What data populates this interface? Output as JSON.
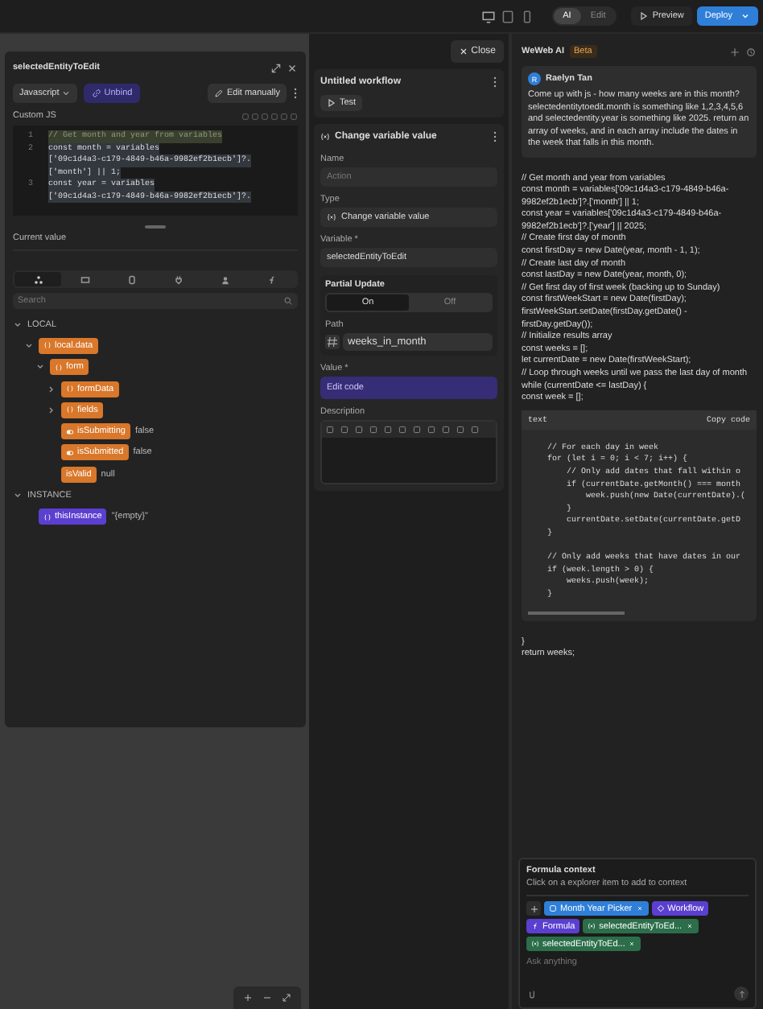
{
  "topbar": {
    "mode_tabs": [
      {
        "label": "AI",
        "selected": true
      },
      {
        "label": "Edit",
        "selected": false
      }
    ],
    "preview": "Preview",
    "deploy": "Deploy"
  },
  "binding_panel": {
    "title": "selectedEntityToEdit",
    "language": "Javascript",
    "unbind": "Unbind",
    "edit_manually": "Edit manually",
    "section": "Custom JS",
    "code_lines": [
      {
        "number": "1",
        "kind": "comment",
        "text": "// Get month and year from variables"
      },
      {
        "number": "2",
        "kind": "code",
        "text": "const month = variables"
      },
      {
        "kind": "code",
        "text": "['09c1d4a3-c179-4849-b46a-9982ef2b1ecb']?."
      },
      {
        "kind": "code",
        "text": "['month'] || 1;"
      },
      {
        "number": "3",
        "kind": "code",
        "text": "const year = variables"
      },
      {
        "kind": "code",
        "text": "['09c1d4a3-c179-4849-b46a-9982ef2b1ecb']?."
      }
    ],
    "current_value_label": "Current value",
    "explorer_tabs": [
      {
        "kind": "tree",
        "selected": true
      },
      {
        "kind": "grid",
        "selected": false
      },
      {
        "kind": "database",
        "selected": false
      },
      {
        "kind": "plug",
        "selected": false
      },
      {
        "kind": "user",
        "selected": false
      },
      {
        "kind": "function",
        "selected": false
      }
    ],
    "search": {
      "placeholder": "Search"
    },
    "tree": [
      {
        "label": "LOCAL",
        "expanded": true,
        "children": [
          {
            "label": "local.data",
            "kind": "object",
            "color": "#d9772a",
            "expanded": true,
            "children": [
              {
                "label": "form",
                "kind": "object",
                "color": "#d9772a",
                "expanded": true,
                "children": [
                  {
                    "label": "formData",
                    "kind": "object",
                    "color": "#d9772a",
                    "expanded": false
                  },
                  {
                    "label": "fields",
                    "kind": "object",
                    "color": "#d9772a",
                    "expanded": false
                  },
                  {
                    "label": "isSubmitting",
                    "kind": "boolean",
                    "color": "#d9772a",
                    "value": "false"
                  },
                  {
                    "label": "isSubmitted",
                    "kind": "boolean",
                    "color": "#d9772a",
                    "value": "false"
                  },
                  {
                    "label": "isValid",
                    "kind": "plain",
                    "color": "#d9772a",
                    "value": "null"
                  }
                ]
              }
            ]
          }
        ]
      },
      {
        "label": "INSTANCE",
        "expanded": true,
        "children": [
          {
            "label": "thisInstance",
            "kind": "object",
            "color": "#5a3fd0",
            "value": "\"{empty}\""
          }
        ]
      }
    ]
  },
  "workflow_panel": {
    "close": "Close",
    "workflow_title": "Untitled workflow",
    "test": "Test",
    "action": {
      "title": "Change variable value",
      "name_label": "Name",
      "name_placeholder": "Action",
      "type_label": "Type",
      "type_value": "Change variable value",
      "variable_label": "Variable *",
      "variable_value": "selectedEntityToEdit",
      "partial_update": {
        "label": "Partial Update",
        "options": [
          {
            "label": "On",
            "selected": true
          },
          {
            "label": "Off",
            "selected": false
          }
        ],
        "path_label": "Path",
        "path_value": "weeks_in_month"
      },
      "value_label": "Value *",
      "value_button": "Edit code",
      "description_label": "Description"
    }
  },
  "ai_panel": {
    "title": "WeWeb AI",
    "badge": "Beta",
    "message": {
      "avatar": "R",
      "author": "Raelyn Tan",
      "text": "Come up with js - how many weeks are in this month? selectedentitytoedit.month is something like 1,2,3,4,5,6 and selectedentity.year is something like 2025. return an array of weeks, and in each array include the dates in the week that falls in this month."
    },
    "response_lines": [
      "// Get month and year from variables",
      "const month = variables['09c1d4a3-c179-4849-b46a-9982ef2b1ecb']?.['month'] || 1;",
      "const year = variables['09c1d4a3-c179-4849-b46a-9982ef2b1ecb']?.['year'] || 2025;",
      "// Create first day of month",
      "const firstDay = new Date(year, month - 1, 1);",
      "// Create last day of month",
      "const lastDay = new Date(year, month, 0);",
      "// Get first day of first week (backing up to Sunday)",
      "const firstWeekStart = new Date(firstDay);",
      "firstWeekStart.setDate(firstDay.getDate() - firstDay.getDay());",
      "// Initialize results array",
      "const weeks = [];",
      "let currentDate = new Date(firstWeekStart);",
      "// Loop through weeks until we pass the last day of month",
      "while (currentDate <= lastDay) {",
      "const week = [];"
    ],
    "code_block": {
      "language": "text",
      "copy": "Copy code",
      "lines": [
        {
          "text": "    // For each day in week"
        },
        {
          "text": "    for (let i = 0; i < 7; i++) {"
        },
        {
          "text": "        // Only add dates that fall within o"
        },
        {
          "text": "        if (currentDate.getMonth() === month"
        },
        {
          "text": "            week.push(new Date(currentDate).("
        },
        {
          "text": "        }"
        },
        {
          "text": "        currentDate.setDate(currentDate.getD"
        },
        {
          "text": "    }"
        },
        {
          "text": "    // Only add weeks that have dates in our",
          "gap_before": true
        },
        {
          "text": "    if (week.length > 0) {"
        },
        {
          "text": "        weeks.push(week);"
        },
        {
          "text": "    }"
        }
      ]
    },
    "after_lines": [
      "}",
      "return weeks;"
    ],
    "formula_context": {
      "title": "Formula context",
      "hint": "Click on a explorer item to add to context",
      "chips": [
        {
          "label": "Month Year Picker",
          "kind": "component",
          "color": "#2f7fd8",
          "removable": true
        },
        {
          "label": "Workflow",
          "kind": "workflow",
          "color": "#5a3fd0",
          "removable": false
        },
        {
          "label": "Formula",
          "kind": "formula",
          "color": "#5a3fd0",
          "removable": false
        },
        {
          "label": "selectedEntityToEd...",
          "kind": "variable",
          "color": "#2c6e4a",
          "removable": true
        },
        {
          "label": "selectedEntityToEd...",
          "kind": "variable",
          "color": "#2c6e4a",
          "removable": true
        }
      ],
      "placeholder": "Ask anything"
    }
  }
}
